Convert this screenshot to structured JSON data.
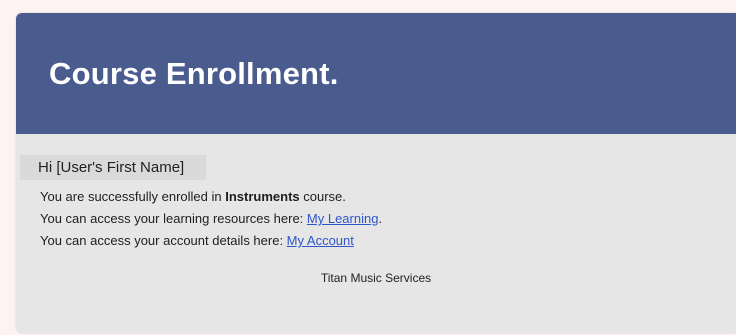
{
  "header": {
    "title": "Course Enrollment."
  },
  "body": {
    "greeting": "Hi [User's First Name]",
    "line1_prefix": "You are successfully enrolled in ",
    "line1_course": "Instruments",
    "line1_suffix": " course.",
    "line2_prefix": "You can access your learning resources here: ",
    "line2_link": "My Learning",
    "line2_suffix": ".",
    "line3_prefix": "You can access your account details here: ",
    "line3_link": "My Account"
  },
  "footer": {
    "text": "Titan Music Services"
  },
  "colors": {
    "header_bg": "#4a5b8e",
    "card_bg": "#e6e6e6",
    "link": "#2f56c9"
  }
}
